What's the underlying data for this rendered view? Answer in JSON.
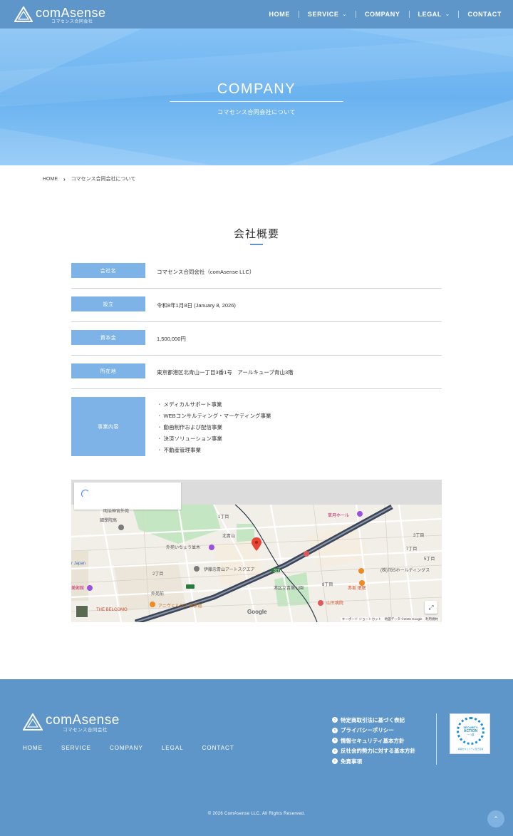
{
  "header": {
    "logo_name": "comAsense",
    "logo_sub": "コマセンス合同会社",
    "nav": [
      {
        "label": "HOME",
        "has_dropdown": false
      },
      {
        "label": "SERVICE",
        "has_dropdown": true
      },
      {
        "label": "COMPANY",
        "has_dropdown": false
      },
      {
        "label": "LEGAL",
        "has_dropdown": true
      },
      {
        "label": "CONTACT",
        "has_dropdown": false
      }
    ],
    "caret_icon": "⌄"
  },
  "hero": {
    "title": "COMPANY",
    "subtitle": "コマセンス合同会社について"
  },
  "breadcrumb": {
    "home": "HOME",
    "separator": "›",
    "current": "コマセンス合同会社について"
  },
  "company": {
    "title": "会社概要",
    "rows": [
      {
        "label": "会社名",
        "value": "コマセンス合同会社（comAsense LLC）"
      },
      {
        "label": "設立",
        "value": "令和8年1月8日 (January 8, 2026)"
      },
      {
        "label": "資本金",
        "value": "1,500,000円"
      },
      {
        "label": "所在地",
        "value": "東京都港区北青山一丁目3番1号　アールキューブ青山3階"
      }
    ],
    "business": {
      "label": "事業内容",
      "items": [
        "メディカルサポート事業",
        "WEBコンサルティング・マーケティング事業",
        "動画制作および配信事業",
        "決済ソリューション事業",
        "不動産管理事業"
      ]
    }
  },
  "map": {
    "labels": {
      "meiji": "明治神宮外苑",
      "kokugakuin": "國學院高",
      "kitaaoyama": "北青山",
      "icho": "外苑いちょう並木",
      "japan": "r Japan",
      "itochu": "伊藤忠青山アートスクエア",
      "gaienmae": "外苑前",
      "bijutsukan": "美術館",
      "belcomo": "THE BELCOMO",
      "anniversaire": "アニヴェルセル 表参道",
      "nichome": "2丁目",
      "itchome": "1丁目",
      "akasaka_koen": "港区立青葉公園",
      "sanno": "山王病院",
      "akasaka": "赤坂 珉珉",
      "tbs": "(株)TBSホールディングス",
      "soka": "草月ホール",
      "sanchome": "3丁目",
      "hachichome": "8丁目",
      "shichome": "7丁目",
      "gochome": "5丁目",
      "road_num": "319",
      "google": "Google",
      "footer": "キーボード ショートカット　地図データ ©2026 Google　利用規約",
      "fullscreen": "⤢"
    },
    "brand_colors": {
      "park": "#c5e6c3",
      "road": "#2e3a4f",
      "highway": "#3b4659",
      "block": "#f5ede0"
    }
  },
  "footer": {
    "logo_name": "comAsense",
    "logo_sub": "コマセンス合同会社",
    "nav": [
      "HOME",
      "SERVICE",
      "COMPANY",
      "LEGAL",
      "CONTACT"
    ],
    "links": [
      "特定商取引法に基づく表記",
      "プライバシーポリシー",
      "情報セキュリティ基本方針",
      "反社会的勢力に対する基本方針",
      "免責事項"
    ],
    "link_icon": "›",
    "badge": {
      "line1": "SECURITY",
      "line2": "ACTION",
      "line3": "一つ星",
      "caption": "情報セキュリティ自己宣言"
    },
    "copyright": "© 2026 ComAsense LLC. All Rights Reserved.",
    "to_top_icon": "⌃"
  },
  "colors": {
    "header_bg": "#5f96c9",
    "label_bg": "#7db3e6",
    "accent": "#5f96c9",
    "footer_bg": "#5f96c9"
  }
}
